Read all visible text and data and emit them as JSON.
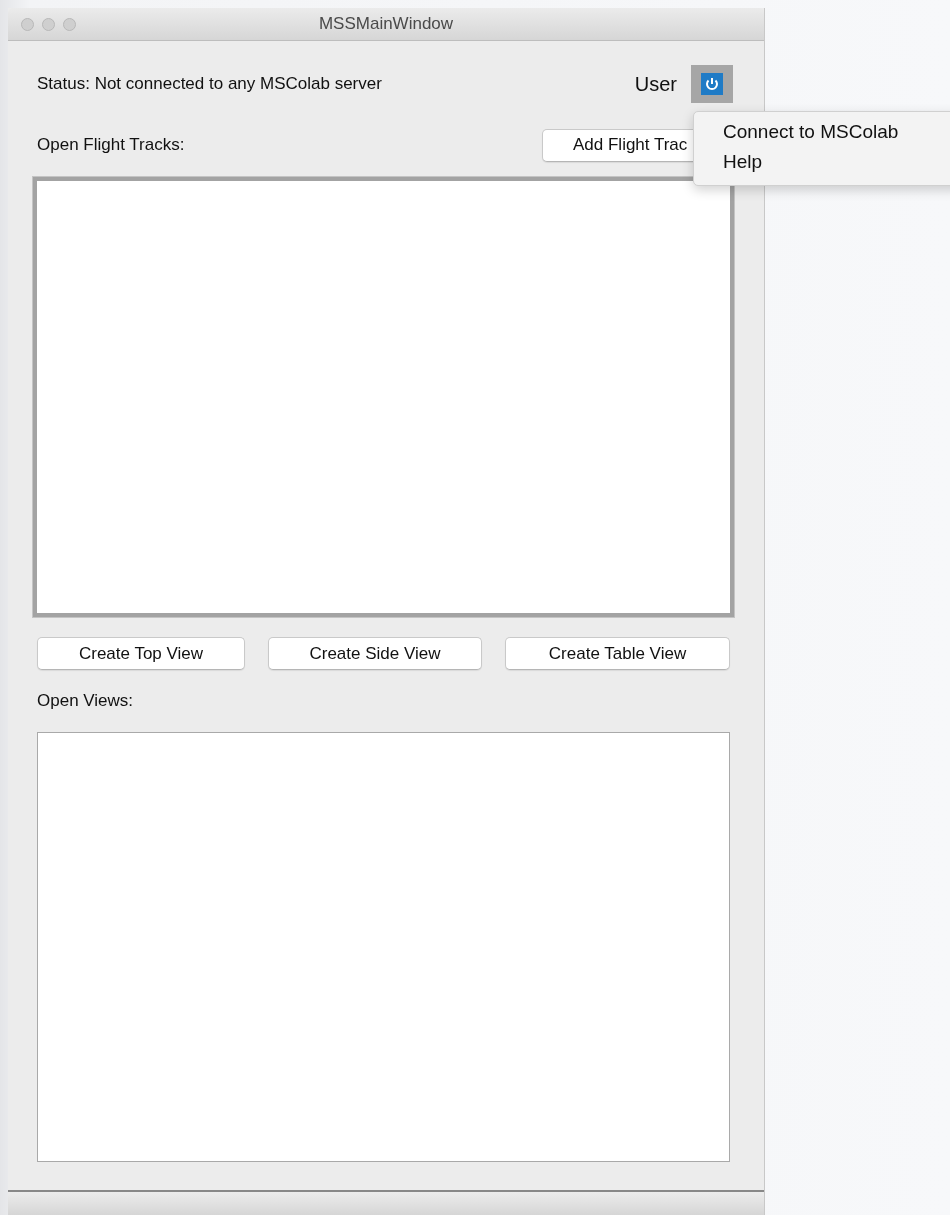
{
  "window": {
    "title": "MSSMainWindow"
  },
  "status": "Status: Not connected to any MSColab server",
  "user_label": "User",
  "flight_tracks": {
    "label": "Open Flight Tracks:",
    "add_button": "Add Flight Trac",
    "focused": true
  },
  "view_buttons": [
    "Create Top View",
    "Create Side View",
    "Create Table View"
  ],
  "views": {
    "label": "Open Views:",
    "focused": false
  },
  "user_menu": {
    "items": [
      "Connect to MSColab",
      "Help"
    ]
  }
}
